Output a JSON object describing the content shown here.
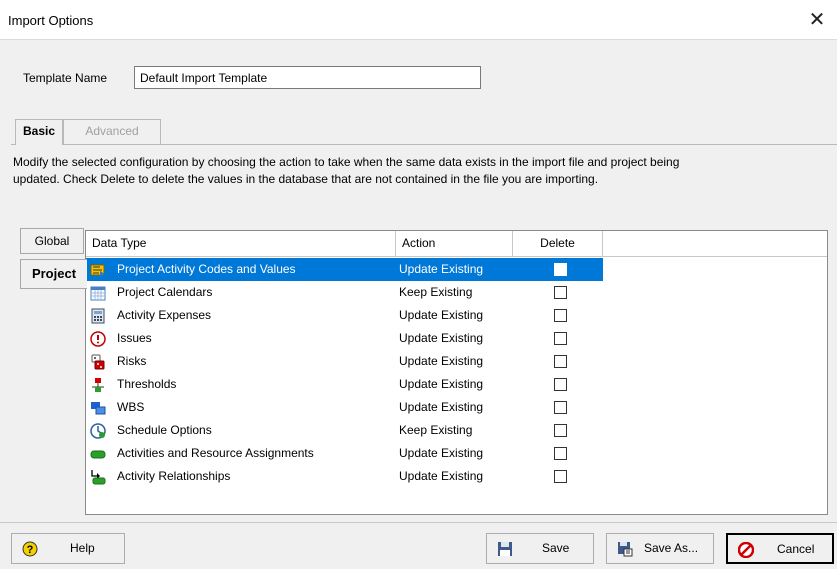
{
  "window": {
    "title": "Import Options",
    "close_glyph": "✕"
  },
  "template": {
    "label": "Template Name",
    "value": "Default Import Template"
  },
  "tabs": [
    {
      "label": "Basic"
    },
    {
      "label": "Advanced"
    }
  ],
  "description": "Modify the selected configuration by choosing the action to take when the same data exists in the import file and project being updated. Check Delete  to delete the values in the database that are not contained in the file you are importing.",
  "side_tabs": [
    {
      "label": "Global"
    },
    {
      "label": "Project"
    }
  ],
  "grid": {
    "columns": {
      "type": "Data Type",
      "action": "Action",
      "delete": "Delete"
    },
    "rows": [
      {
        "type": "Project Activity Codes and Values",
        "action": "Update Existing",
        "delete": false,
        "icon": "activity-codes-icon",
        "selected": true
      },
      {
        "type": "Project Calendars",
        "action": "Keep Existing",
        "delete": false,
        "icon": "calendar-icon"
      },
      {
        "type": "Activity Expenses",
        "action": "Update Existing",
        "delete": false,
        "icon": "calculator-icon"
      },
      {
        "type": "Issues",
        "action": "Update Existing",
        "delete": false,
        "icon": "issue-icon"
      },
      {
        "type": "Risks",
        "action": "Update Existing",
        "delete": false,
        "icon": "risk-dice-icon"
      },
      {
        "type": "Thresholds",
        "action": "Update Existing",
        "delete": false,
        "icon": "thresholds-icon"
      },
      {
        "type": "WBS",
        "action": "Update Existing",
        "delete": false,
        "icon": "wbs-icon"
      },
      {
        "type": "Schedule Options",
        "action": "Keep Existing",
        "delete": false,
        "icon": "clock-icon"
      },
      {
        "type": "Activities and Resource Assignments",
        "action": "Update Existing",
        "delete": false,
        "icon": "activity-bar-icon"
      },
      {
        "type": "Activity Relationships",
        "action": "Update Existing",
        "delete": false,
        "icon": "relationship-icon"
      }
    ]
  },
  "buttons": {
    "help": "Help",
    "save": "Save",
    "save_as": "Save As...",
    "cancel": "Cancel"
  },
  "colors": {
    "selection": "#0078d7",
    "background": "#f0f0f0"
  }
}
